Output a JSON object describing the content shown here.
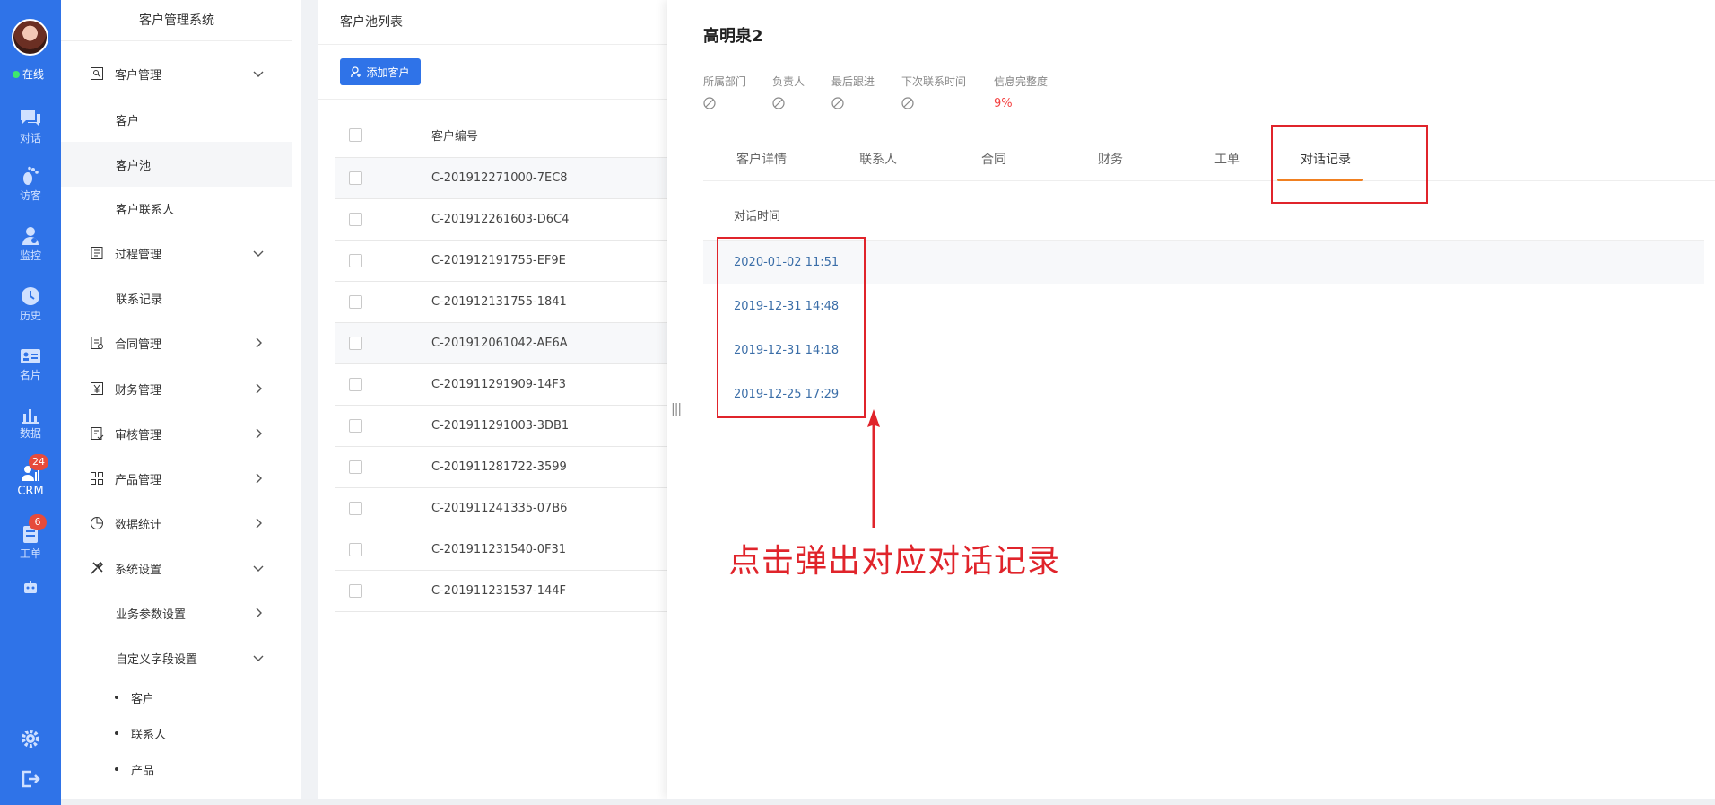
{
  "rail": {
    "online_label": "在线",
    "items": [
      {
        "label": "对话",
        "icon": "chat-icon"
      },
      {
        "label": "访客",
        "icon": "footprint-icon"
      },
      {
        "label": "监控",
        "icon": "monitor-user-icon"
      },
      {
        "label": "历史",
        "icon": "clock-icon"
      },
      {
        "label": "名片",
        "icon": "card-icon"
      },
      {
        "label": "数据",
        "icon": "bar-chart-icon"
      },
      {
        "label": "CRM",
        "icon": "crm-icon",
        "badge": "24"
      },
      {
        "label": "工单",
        "icon": "ticket-icon",
        "badge": "6"
      },
      {
        "label": "",
        "icon": "robot-icon"
      }
    ],
    "bottom": [
      {
        "icon": "gear-icon"
      },
      {
        "icon": "logout-icon"
      }
    ],
    "accent": "#2f73e8",
    "badge_color": "#e64b3b"
  },
  "menu": {
    "title": "客户管理系统",
    "customer_mgmt": "客户管理",
    "customer": "客户",
    "customer_pool": "客户池",
    "customer_contacts": "客户联系人",
    "process_mgmt": "过程管理",
    "contact_records": "联系记录",
    "contract_mgmt": "合同管理",
    "finance_mgmt": "财务管理",
    "audit_mgmt": "审核管理",
    "product_mgmt": "产品管理",
    "data_stats": "数据统计",
    "system_settings": "系统设置",
    "business_params": "业务参数设置",
    "custom_fields": "自定义字段设置",
    "cf_customer": "客户",
    "cf_contact": "联系人",
    "cf_product": "产品"
  },
  "list": {
    "title": "客户池列表",
    "add_button": "添加客户",
    "col_id": "客户编号",
    "rows": [
      "C-201912271000-7EC8",
      "C-201912261603-D6C4",
      "C-201912191755-EF9E",
      "C-201912131755-1841",
      "C-201912061042-AE6A",
      "C-201911291909-14F3",
      "C-201911291003-3DB1",
      "C-201911281722-3599",
      "C-201911241335-07B6",
      "C-201911231540-0F31",
      "C-201911231537-144F"
    ]
  },
  "detail": {
    "title": "高明泉2",
    "meta": {
      "dept_label": "所属部门",
      "owner_label": "负责人",
      "last_follow_label": "最后跟进",
      "next_contact_label": "下次联系时间",
      "completeness_label": "信息完整度",
      "completeness_value": "9%"
    },
    "tabs": [
      "客户详情",
      "联系人",
      "合同",
      "财务",
      "工单",
      "对话记录"
    ],
    "active_tab": "对话记录",
    "records_header": "对话时间",
    "records": [
      "2020-01-02 11:51",
      "2019-12-31 14:48",
      "2019-12-31 14:18",
      "2019-12-25 17:29"
    ],
    "annotation": "点击弹出对应对话记录",
    "annotation_color": "#e0242b",
    "tab_underline_color": "#f08021"
  }
}
